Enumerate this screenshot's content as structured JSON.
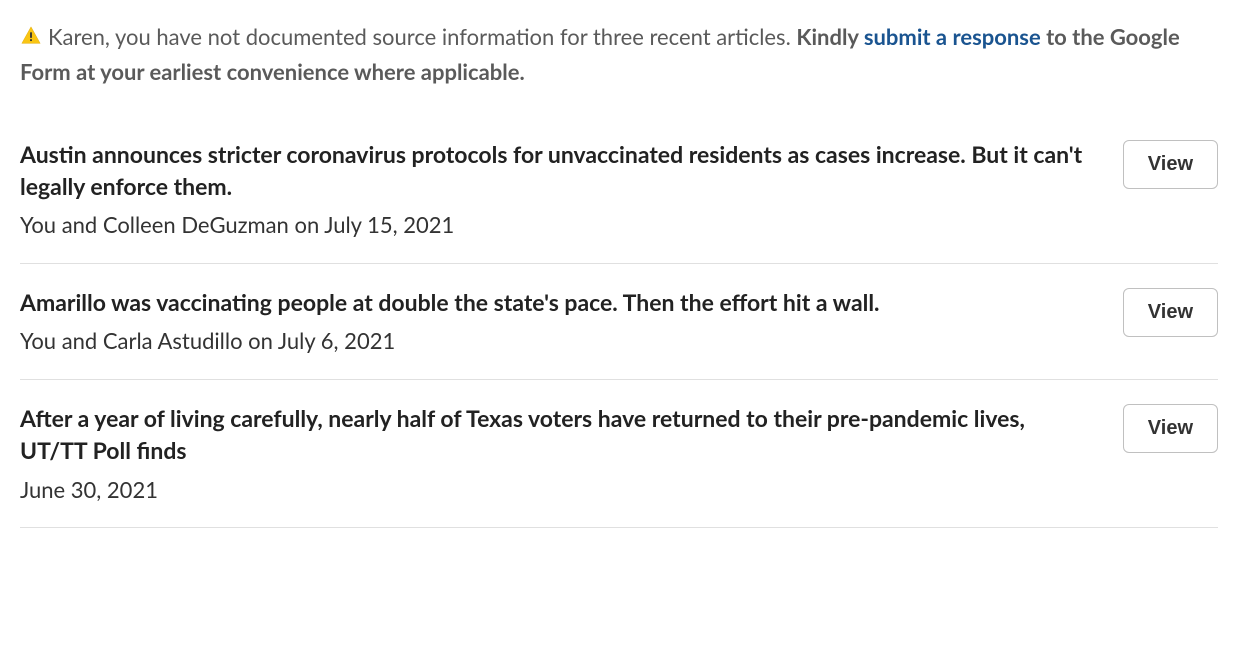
{
  "alert": {
    "message_part1": "Karen, you have not documented source information for three recent articles. ",
    "message_bold_prefix": "Kindly ",
    "link_text": "submit a response",
    "message_part2": " to the Google Form at your earliest convenience where applicable."
  },
  "articles": [
    {
      "title": "Austin announces stricter coronavirus protocols for unvaccinated residents as cases increase. But it can't legally enforce them.",
      "meta": "You and Colleen DeGuzman on July 15, 2021",
      "button_label": "View"
    },
    {
      "title": "Amarillo was vaccinating people at double the state's pace. Then the effort hit a wall.",
      "meta": "You and Carla Astudillo on July 6, 2021",
      "button_label": "View"
    },
    {
      "title": "After a year of living carefully, nearly half of Texas voters have returned to their pre-pandemic lives, UT/TT Poll finds",
      "meta": "June 30, 2021",
      "button_label": "View"
    }
  ]
}
